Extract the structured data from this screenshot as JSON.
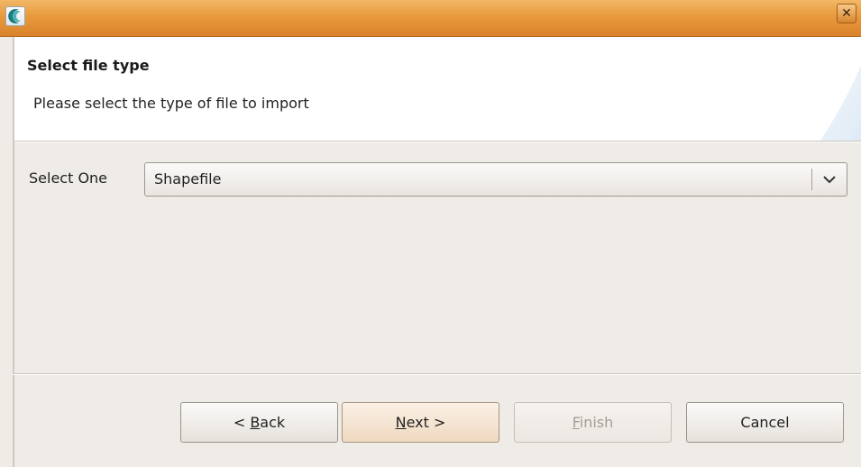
{
  "window": {
    "title": "",
    "app_icon": "eclipse-crescent-icon",
    "close_glyph": "✕"
  },
  "banner": {
    "title": "Select file type",
    "description": "Please select the type of file to import"
  },
  "form": {
    "select_label": "Select One",
    "select_value": "Shapefile"
  },
  "buttons": {
    "back": {
      "prefix": "< ",
      "mnemonic": "B",
      "rest": "ack"
    },
    "next": {
      "mnemonic": "N",
      "rest": "ext >"
    },
    "finish": {
      "mnemonic": "F",
      "rest": "inish",
      "disabled": true
    },
    "cancel": "Cancel"
  },
  "colors": {
    "titlebar": "#e89a3c",
    "banner_bg": "#ffffff",
    "dialog_bg": "#efebe7",
    "default_button": "#efd9c0"
  }
}
